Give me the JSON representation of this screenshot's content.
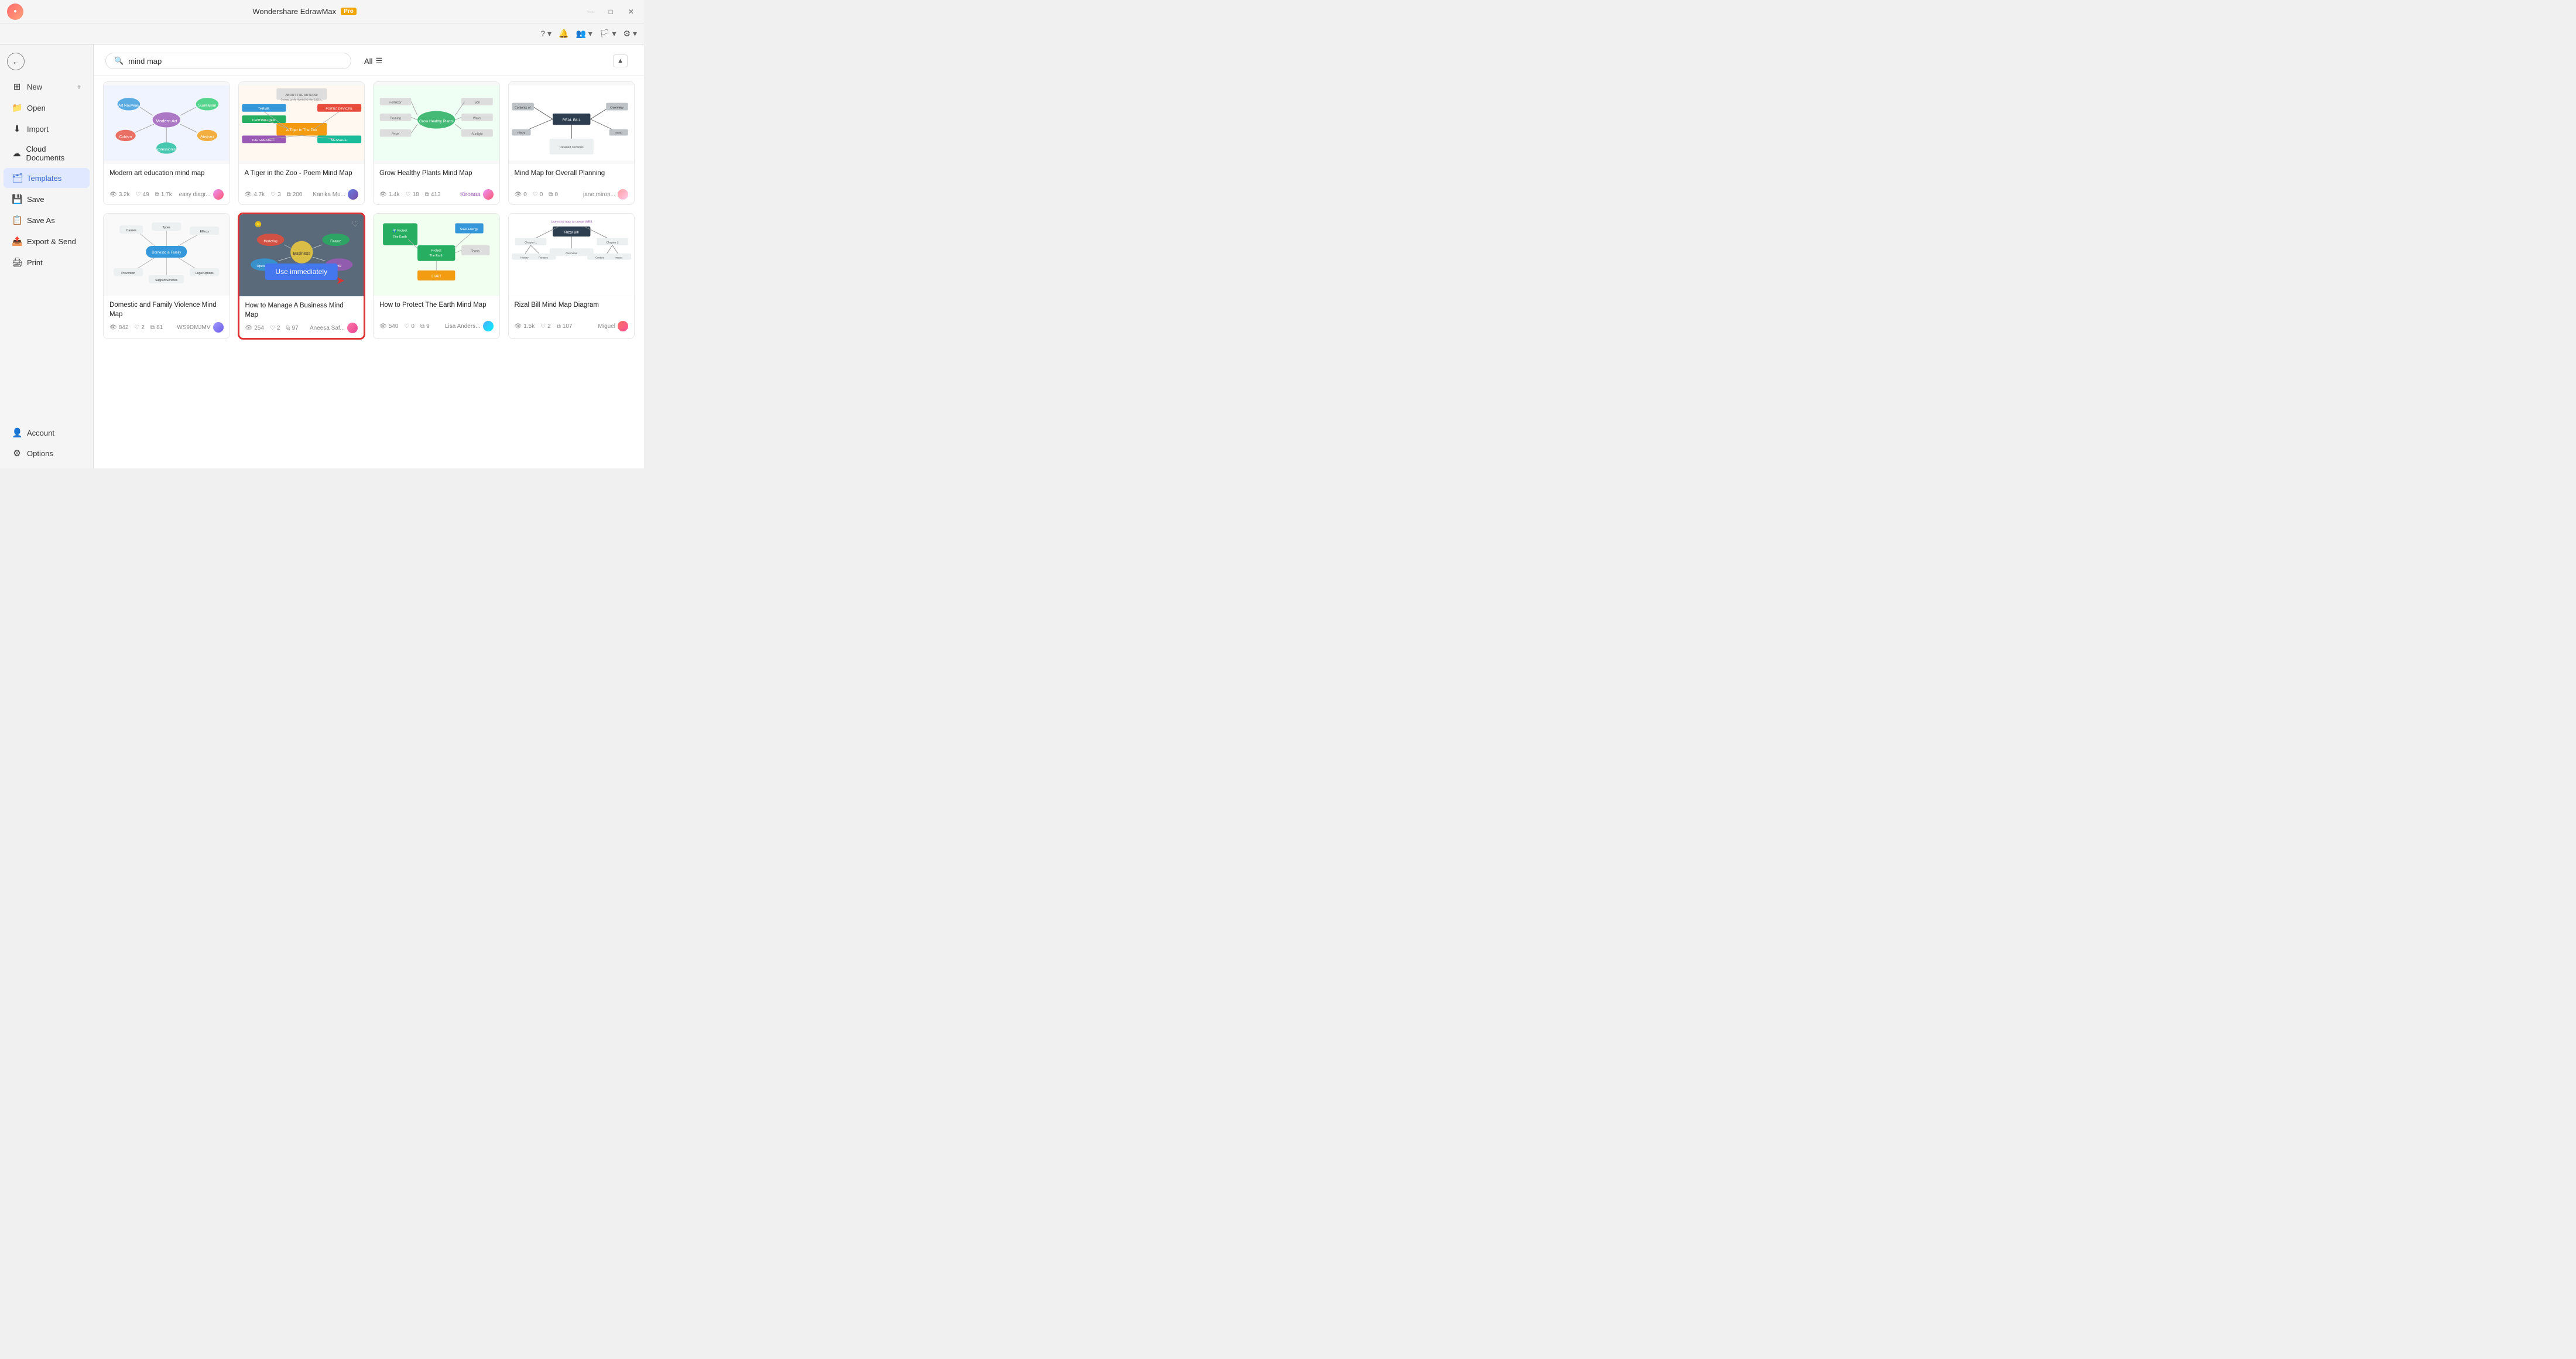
{
  "app": {
    "title": "Wondershare EdrawMax",
    "pro_badge": "Pro"
  },
  "search": {
    "value": "mind map",
    "placeholder": "mind map",
    "filter_label": "All"
  },
  "sidebar": {
    "items": [
      {
        "id": "new",
        "label": "New",
        "icon": "+"
      },
      {
        "id": "open",
        "label": "Open",
        "icon": "📁"
      },
      {
        "id": "import",
        "label": "Import",
        "icon": "⬇"
      },
      {
        "id": "cloud",
        "label": "Cloud Documents",
        "icon": "☁"
      },
      {
        "id": "templates",
        "label": "Templates",
        "icon": "🗂",
        "active": true
      },
      {
        "id": "save",
        "label": "Save",
        "icon": "💾"
      },
      {
        "id": "saveas",
        "label": "Save As",
        "icon": "📋"
      },
      {
        "id": "export",
        "label": "Export & Send",
        "icon": "📤"
      },
      {
        "id": "print",
        "label": "Print",
        "icon": "🖨"
      }
    ],
    "bottom_items": [
      {
        "id": "account",
        "label": "Account",
        "icon": "👤"
      },
      {
        "id": "options",
        "label": "Options",
        "icon": "⚙"
      }
    ]
  },
  "cards": [
    {
      "id": "card1",
      "title": "Modern art education mind map",
      "views": "3.2k",
      "likes": "49",
      "copies": "1.7k",
      "author": "easy diagr...",
      "author_avatar": "orange",
      "highlighted": false
    },
    {
      "id": "card2",
      "title": "A Tiger in the Zoo - Poem Mind Map",
      "views": "4.7k",
      "likes": "3",
      "copies": "200",
      "author": "Kanika Mu...",
      "author_avatar": "pink",
      "highlighted": false
    },
    {
      "id": "card3",
      "title": "Grow Healthy Plants Mind Map",
      "views": "1.4k",
      "likes": "18",
      "copies": "413",
      "author": "Kiroaaa",
      "author_avatar": "orange",
      "highlighted": false,
      "author_color": "purple"
    },
    {
      "id": "card4",
      "title": "Mind Map for Overall Planning",
      "views": "0",
      "likes": "0",
      "copies": "0",
      "author": "jane.miron...",
      "author_avatar": "pink2",
      "highlighted": false
    },
    {
      "id": "card5",
      "title": "Domestic and Family Violence Mind Map",
      "views": "842",
      "likes": "2",
      "copies": "81",
      "author": "WS9DMJMV",
      "author_avatar": "purple",
      "highlighted": false
    },
    {
      "id": "card6",
      "title": "How to Manage A Business Mind Map",
      "views": "254",
      "likes": "2",
      "copies": "97",
      "author": "Aneesa Saf...",
      "author_avatar": "pink3",
      "highlighted": true,
      "use_btn_label": "Use immediately"
    },
    {
      "id": "card7",
      "title": "How to Protect The Earth Mind Map",
      "views": "540",
      "likes": "0",
      "copies": "9",
      "author": "Lisa Anders...",
      "author_avatar": "teal",
      "highlighted": false
    },
    {
      "id": "card8",
      "title": "Rizal Bill Mind Map Diagram",
      "views": "1.5k",
      "likes": "2",
      "copies": "107",
      "author": "Miguel",
      "author_avatar": "red",
      "highlighted": false
    }
  ],
  "toolbar": {
    "help_icon": "?",
    "bell_icon": "🔔",
    "users_icon": "👥",
    "flag_icon": "🏳",
    "settings_icon": "⚙"
  }
}
